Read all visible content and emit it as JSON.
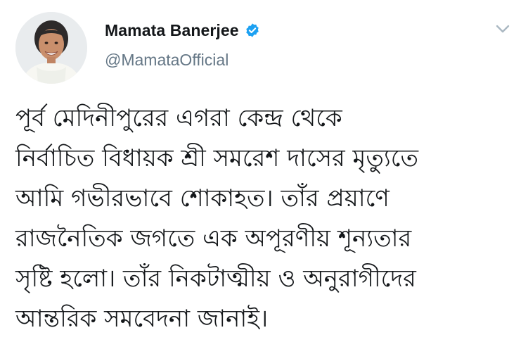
{
  "tweet": {
    "author": {
      "display_name": "Mamata Banerjee",
      "handle": "@MamataOfficial",
      "verified": true,
      "verified_icon": "verified-badge-icon",
      "avatar": "profile-photo"
    },
    "menu_icon": "chevron-down-icon",
    "text_lines": [
      "পূর্ব মেদিনীপুরের এগরা কেন্দ্র থেকে",
      "নির্বাচিত বিধায়ক শ্রী সমরেশ দাসের মৃত্যুতে",
      "আমি গভীরভাবে শোকাহত। তাঁর প্রয়াণে",
      "রাজনৈতিক জগতে এক অপূরণীয় শূন্যতার",
      "সৃষ্টি হলো। তাঁর নিকটাত্মীয় ও অনুরাগীদের",
      "আন্তরিক সমবেদনা জানাই।"
    ]
  },
  "colors": {
    "verified_blue": "#1da1f2",
    "handle_gray": "#657786",
    "caret_gray": "#aab8c2",
    "text": "#14171a"
  }
}
